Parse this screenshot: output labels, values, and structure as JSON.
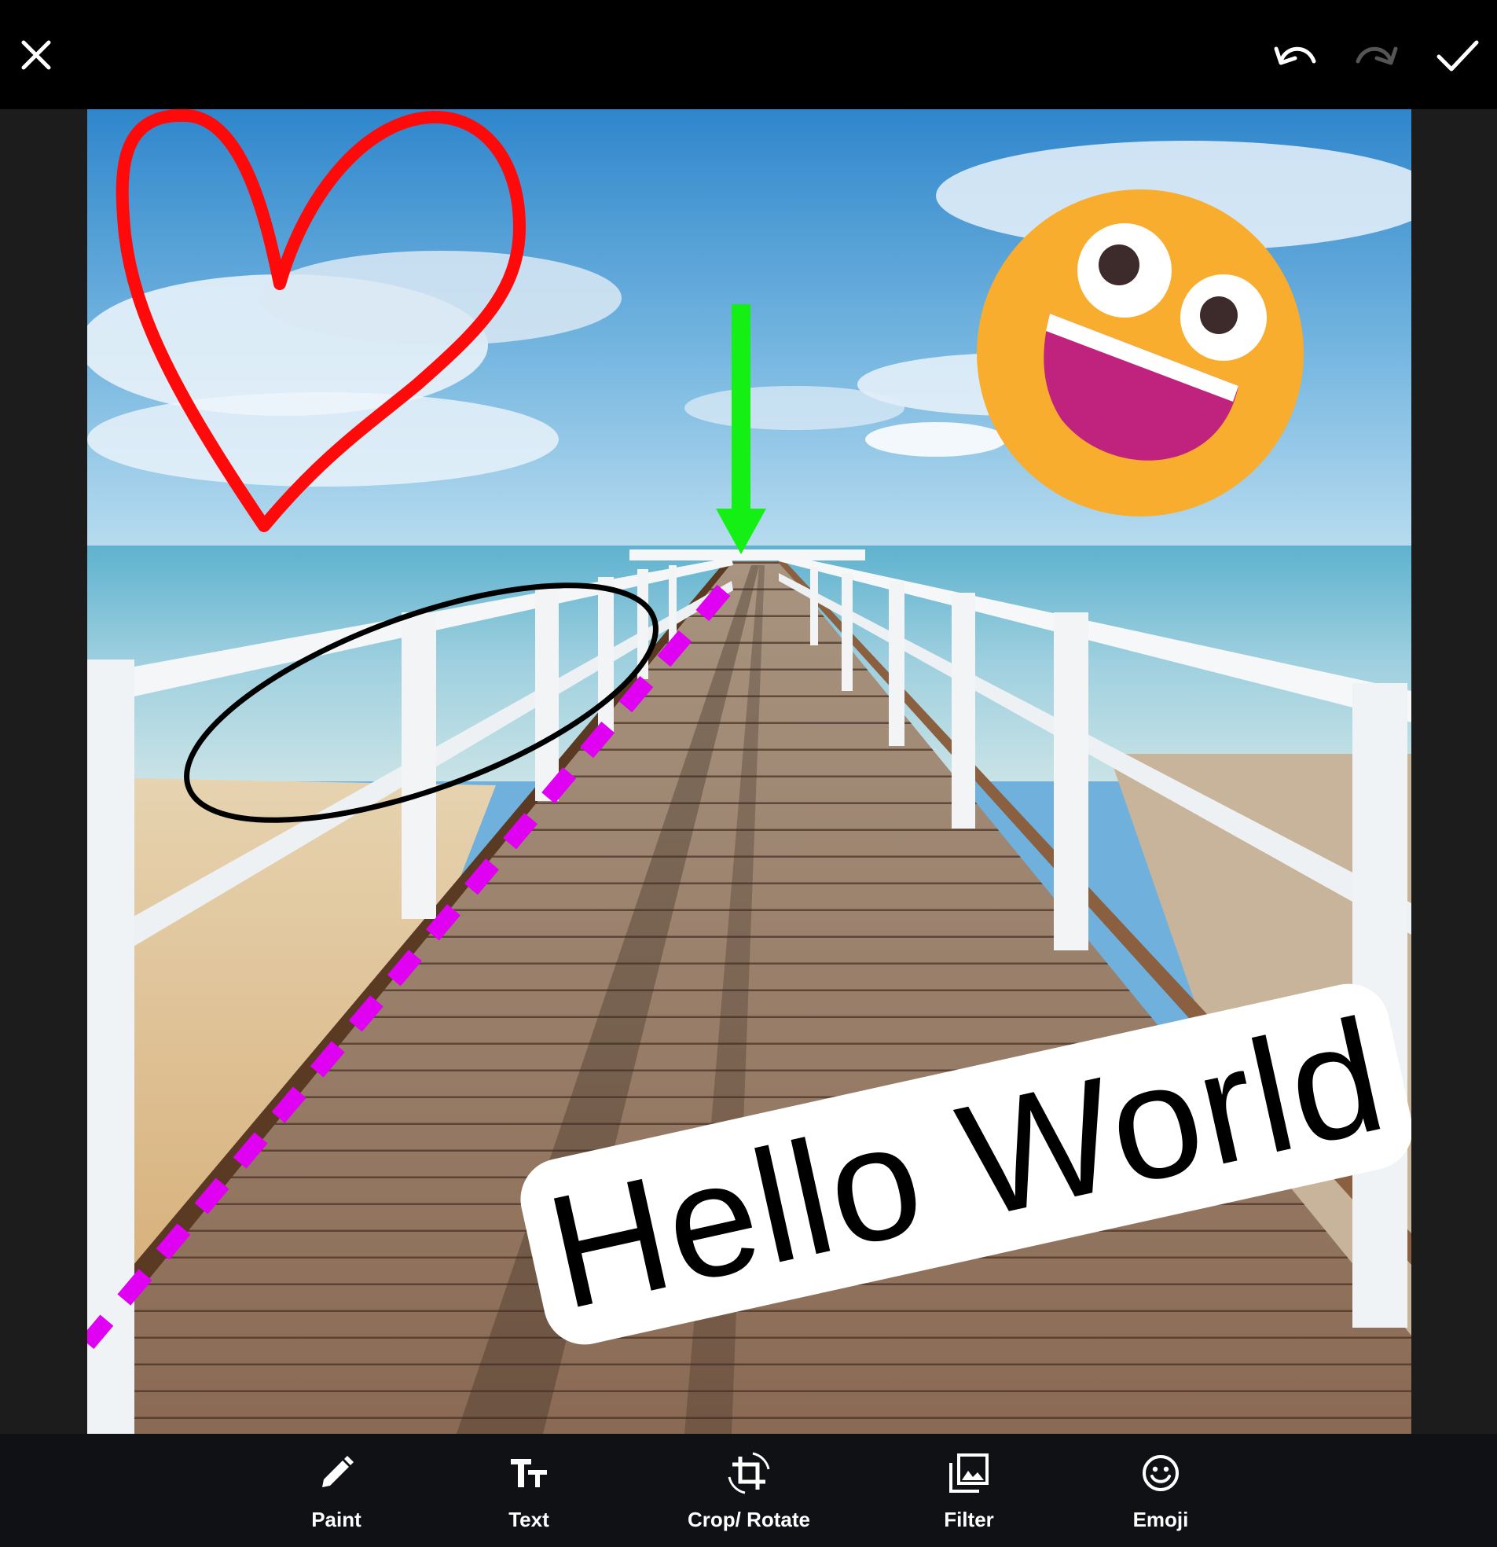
{
  "header": {
    "close_icon": "close-icon",
    "undo_icon": "undo-icon",
    "redo_icon": "redo-icon",
    "confirm_icon": "check-icon"
  },
  "canvas": {
    "text_sticker": "Hello World",
    "colors": {
      "heart": "#ff0a0a",
      "arrow": "#14f014",
      "dashed_line": "#e000f2",
      "ellipse": "#000000",
      "emoji_face": "#f8ad2e",
      "emoji_mouth": "#c0237d"
    }
  },
  "toolbar": {
    "tools": [
      {
        "label": "Paint",
        "icon": "pencil-icon"
      },
      {
        "label": "Text",
        "icon": "text-size-icon"
      },
      {
        "label": "Crop/ Rotate",
        "icon": "crop-rotate-icon"
      },
      {
        "label": "Filter",
        "icon": "filter-icon"
      },
      {
        "label": "Emoji",
        "icon": "smiley-icon"
      }
    ]
  }
}
